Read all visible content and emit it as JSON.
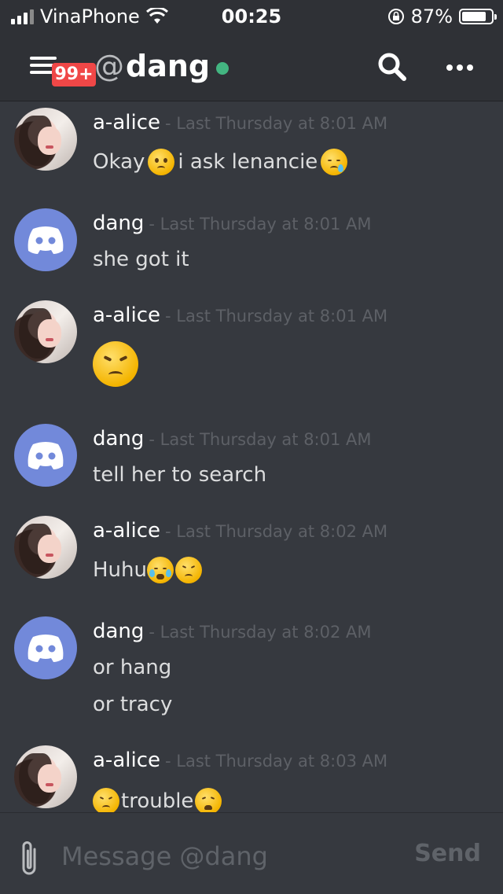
{
  "status_bar": {
    "carrier": "VinaPhone",
    "time": "00:25",
    "battery": "87%",
    "battery_level": 0.87,
    "icons": [
      "signal-icon",
      "wifi-icon",
      "rotation-lock-icon",
      "battery-icon"
    ]
  },
  "header": {
    "badge": "99+",
    "at_symbol": "@",
    "channel_name": "dang",
    "status_color": "#43b581",
    "icons": [
      "menu-icon",
      "search-icon",
      "more-icon"
    ]
  },
  "messages": [
    {
      "author": "a-alice",
      "timestamp": "- Last Thursday at 8:01 AM",
      "avatar": "photo",
      "lines": [
        [
          "Okay ",
          "emoji:frowning-face",
          " i ask lenancie ",
          "emoji:sleepy-face"
        ]
      ]
    },
    {
      "author": "dang",
      "timestamp": "- Last Thursday at 8:01 AM",
      "avatar": "discord-logo",
      "lines": [
        [
          "she got it"
        ]
      ]
    },
    {
      "author": "a-alice",
      "timestamp": "- Last Thursday at 8:01 AM",
      "avatar": "photo",
      "lines": [
        [
          "emoji:persevering-face-large"
        ]
      ]
    },
    {
      "author": "dang",
      "timestamp": "- Last Thursday at 8:01 AM",
      "avatar": "discord-logo",
      "lines": [
        [
          "tell her to search"
        ]
      ]
    },
    {
      "author": "a-alice",
      "timestamp": "- Last Thursday at 8:02 AM",
      "avatar": "photo",
      "lines": [
        [
          "Huhu",
          "emoji:crying-face",
          "emoji:persevering-face"
        ]
      ]
    },
    {
      "author": "dang",
      "timestamp": "- Last Thursday at 8:02 AM",
      "avatar": "discord-logo",
      "lines": [
        [
          "or hang"
        ],
        [
          "or tracy"
        ]
      ]
    },
    {
      "author": "a-alice",
      "timestamp": "- Last Thursday at 8:03 AM",
      "avatar": "photo",
      "lines": [
        [
          "emoji:persevering-face",
          "trouble",
          "emoji:weary-face"
        ]
      ]
    }
  ],
  "composer": {
    "placeholder": "Message @dang",
    "send_label": "Send",
    "icons": [
      "paperclip-icon"
    ]
  },
  "colors": {
    "background": "#36393f",
    "header": "#2f3136",
    "blurple": "#7289da",
    "badge": "#f04747"
  }
}
